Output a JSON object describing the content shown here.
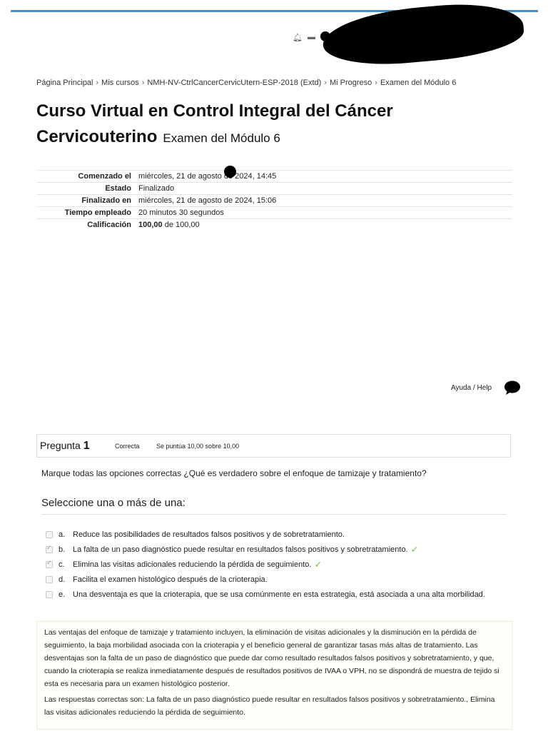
{
  "header": {
    "notification_icon": "bell-icon",
    "message_icon": "chat-icon"
  },
  "breadcrumb": [
    "Página Principal",
    "Mis cursos",
    "NMH-NV-CtrlCancerCervicUtern-ESP-2018 (Extd)",
    "Mi Progreso",
    "Examen del Módulo 6"
  ],
  "course": {
    "title": "Curso Virtual en Control Integral del Cáncer Cervicouterino",
    "subtitle": "Examen del Módulo 6"
  },
  "summary": {
    "started_label": "Comenzado el",
    "started_value": "miércoles, 21 de agosto de 2024, 14:45",
    "state_label": "Estado",
    "state_value": "Finalizado",
    "finished_label": "Finalizado en",
    "finished_value": "miércoles, 21 de agosto de 2024, 15:06",
    "time_label": "Tiempo empleado",
    "time_value": "20 minutos 30 segundos",
    "grade_label": "Calificación",
    "grade_value": "100,00",
    "grade_suffix": "de 100,00"
  },
  "help": {
    "label": "Ayuda / Help",
    "icon": "chat-bubble-icon"
  },
  "question": {
    "label": "Pregunta",
    "number": "1",
    "state": "Correcta",
    "grade": "Se puntúa 10,00 sobre 10,00",
    "text": "Marque todas las opciones correctas ¿Qué es verdadero sobre el enfoque de tamizaje y tratamiento?",
    "prompt": "Seleccione una o más de una:",
    "answers": [
      {
        "letter": "a.",
        "text": "Reduce las posibilidades de resultados falsos positivos y de sobretratamiento.",
        "checked": false,
        "correct": false
      },
      {
        "letter": "b.",
        "text": "La falta de un paso diagnóstico puede resultar en resultados falsos positivos y sobretratamiento.",
        "checked": true,
        "correct": true
      },
      {
        "letter": "c.",
        "text": "Elimina las visitas adicionales reduciendo la pérdida de seguimiento.",
        "checked": true,
        "correct": true
      },
      {
        "letter": "d.",
        "text": "Facilita el examen histológico después de la crioterapia.",
        "checked": false,
        "correct": false
      },
      {
        "letter": "e.",
        "text": "Una desventaja es que la crioterapia, que se usa comúnmente en esta estrategia, está asociada a una alta morbilidad.",
        "checked": false,
        "correct": false
      }
    ],
    "feedback": "Las ventajas del enfoque de tamizaje y tratamiento incluyen, la eliminación de visitas adicionales y la disminución en la pérdida de seguimiento, la baja morbilidad asociada con la crioterapia y el beneficio general de garantizar tasas más altas de tratamiento. Las desventajas son la falta de un paso de diagnóstico que puede dar como resultado resultados falsos positivos y sobretratamiento, y que, cuando la crioterapia se realiza inmediatamente después de resultados positivos de IVAA o VPH, no se dispondrá de muestra de tejido si esta es necesaria para un examen histológico posterior.",
    "right_answer": "Las respuestas correctas son: La falta de un paso diagnóstico puede resultar en resultados falsos positivos y sobretratamiento., Elimina las visitas adicionales reduciendo la pérdida de seguimiento."
  },
  "colors": {
    "accent": "#4a90c8",
    "correct_tick": "#7ac143"
  }
}
